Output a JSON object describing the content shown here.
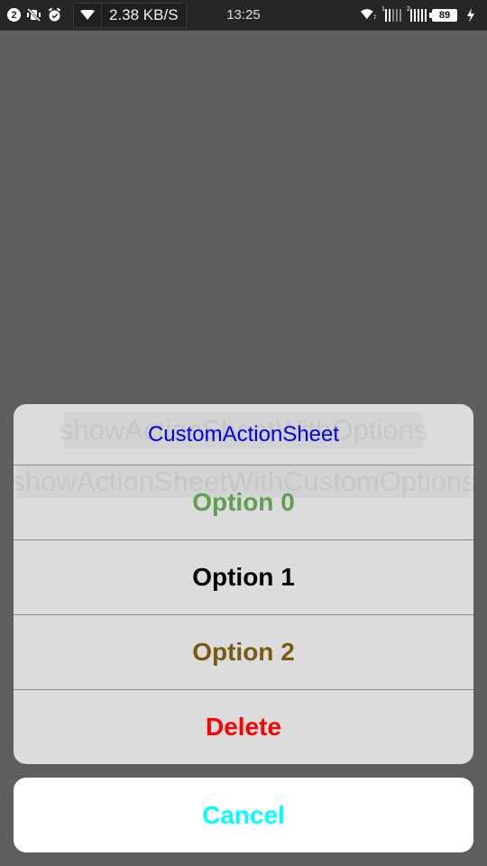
{
  "status_bar": {
    "notification_count": "2",
    "net_speed": "2.38 KB/S",
    "time": "13:25",
    "sim1_label": "1",
    "sim2_label": "2",
    "battery_level": "89"
  },
  "action_sheet": {
    "title": "CustomActionSheet",
    "title_color": "#0000ee",
    "background_button_1": "showActionSheetWithOptions",
    "background_button_2": "showActionSheetWithCustomOptions",
    "options": [
      {
        "label": "Option 0",
        "color": "#5fa04e"
      },
      {
        "label": "Option 1",
        "color": "#000000"
      },
      {
        "label": "Option 2",
        "color": "#7a5a10"
      },
      {
        "label": "Delete",
        "color": "#ff0000"
      }
    ],
    "cancel": {
      "label": "Cancel",
      "color": "#00ffff"
    }
  }
}
